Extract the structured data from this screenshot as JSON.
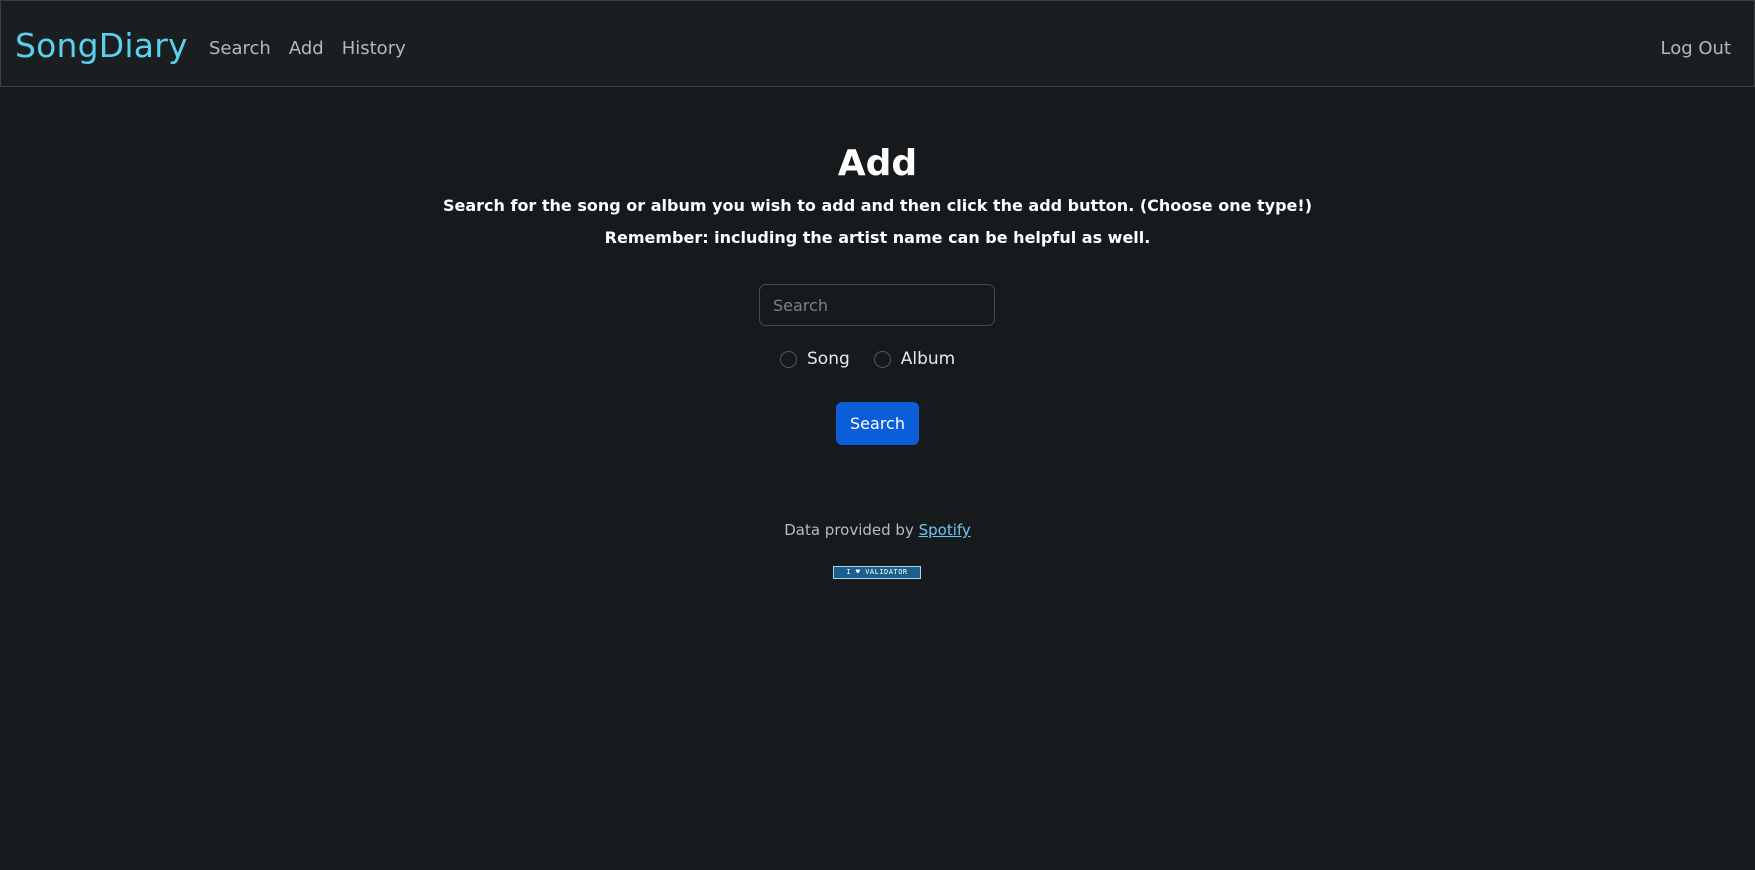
{
  "navbar": {
    "brand": "SongDiary",
    "links": [
      "Search",
      "Add",
      "History"
    ],
    "logout": "Log Out"
  },
  "main": {
    "title": "Add",
    "instruction_1": "Search for the song or album you wish to add and then click the add button. (Choose one type!)",
    "instruction_2": "Remember: including the artist name can be helpful as well.",
    "search": {
      "placeholder": "Search",
      "value": ""
    },
    "options": [
      "Song",
      "Album"
    ],
    "button_label": "Search"
  },
  "footer": {
    "credit_prefix": "Data provided by ",
    "credit_link": "Spotify",
    "badge_text": "I ♥ VALIDATOR"
  },
  "colors": {
    "brand": "#5ad0ef",
    "button": "#0b5ed7",
    "background": "#161a1c"
  }
}
